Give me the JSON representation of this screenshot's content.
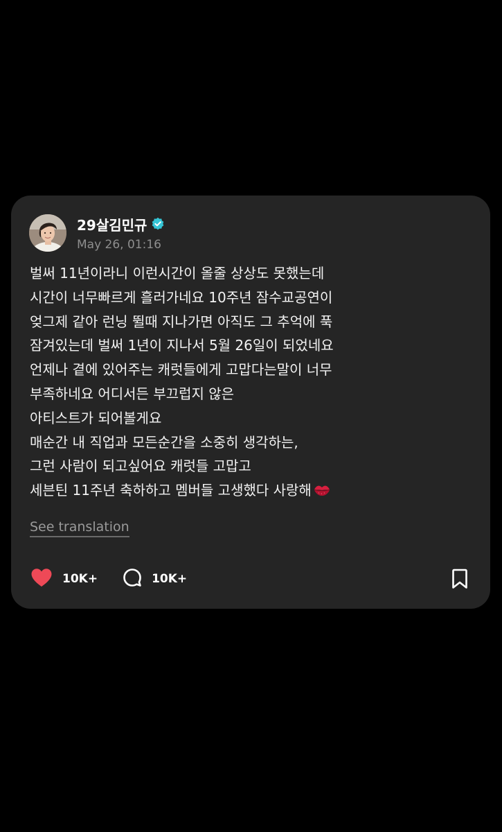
{
  "post": {
    "username": "29살김민규",
    "timestamp": "May 26, 01:16",
    "body_lines": [
      "벌써 11년이라니 이런시간이 올줄 상상도 못했는데",
      "시간이 너무빠르게 흘러가네요 10주년 잠수교공연이",
      "엊그제 같아 런닝 뛸때 지나가면 아직도 그 추억에 푹",
      "잠겨있는데 벌써 1년이 지나서 5월 26일이 되었네요",
      "언제나 곁에 있어주는 캐럿들에게 고맙다는말이 너무",
      "부족하네요 어디서든 부끄럽지 않은",
      "아티스트가 되어볼게요",
      "매순간 내 직업과 모든순간을 소중히 생각하는,",
      "그런 사람이 되고싶어요 캐럿들 고맙고",
      "세븐틴 11주년 축하하고 멤버들 고생했다 사랑해"
    ],
    "emoji_icon": "kiss-mark-icon",
    "see_translation": "See translation",
    "likes": "10K+",
    "comments": "10K+"
  },
  "colors": {
    "background": "#000000",
    "card": "#252525",
    "verified": "#35c5d6",
    "like": "#ee4957",
    "muted": "#8e8e8e"
  }
}
